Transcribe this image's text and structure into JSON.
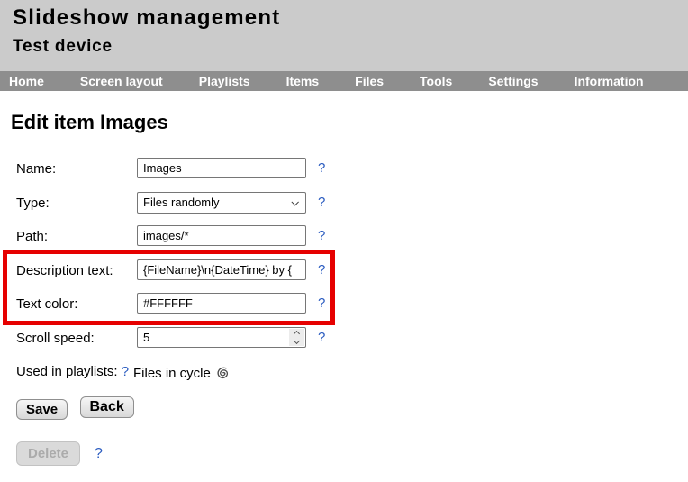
{
  "header": {
    "title": "Slideshow management",
    "subtitle": "Test device"
  },
  "nav": {
    "items": [
      "Home",
      "Screen layout",
      "Playlists",
      "Items",
      "Files",
      "Tools",
      "Settings",
      "Information"
    ]
  },
  "page": {
    "heading": "Edit item Images"
  },
  "form": {
    "help_symbol": "?",
    "fields": {
      "name": {
        "label": "Name:",
        "value": "Images"
      },
      "type": {
        "label": "Type:",
        "value": "Files randomly"
      },
      "path": {
        "label": "Path:",
        "value": "images/*"
      },
      "description": {
        "label": "Description text:",
        "value": "{FileName}\\n{DateTime} by {"
      },
      "text_color": {
        "label": "Text color:",
        "value": "#FFFFFF"
      },
      "scroll_speed": {
        "label": "Scroll speed:",
        "value": "5"
      },
      "used_in_playlists": {
        "label": "Used in playlists:",
        "link_label": "Files in cycle"
      }
    },
    "buttons": {
      "save": "Save",
      "back": "Back",
      "delete": "Delete"
    }
  },
  "annotation": {
    "highlight_color": "#e60000",
    "help_link_color": "#2b5cc0"
  }
}
